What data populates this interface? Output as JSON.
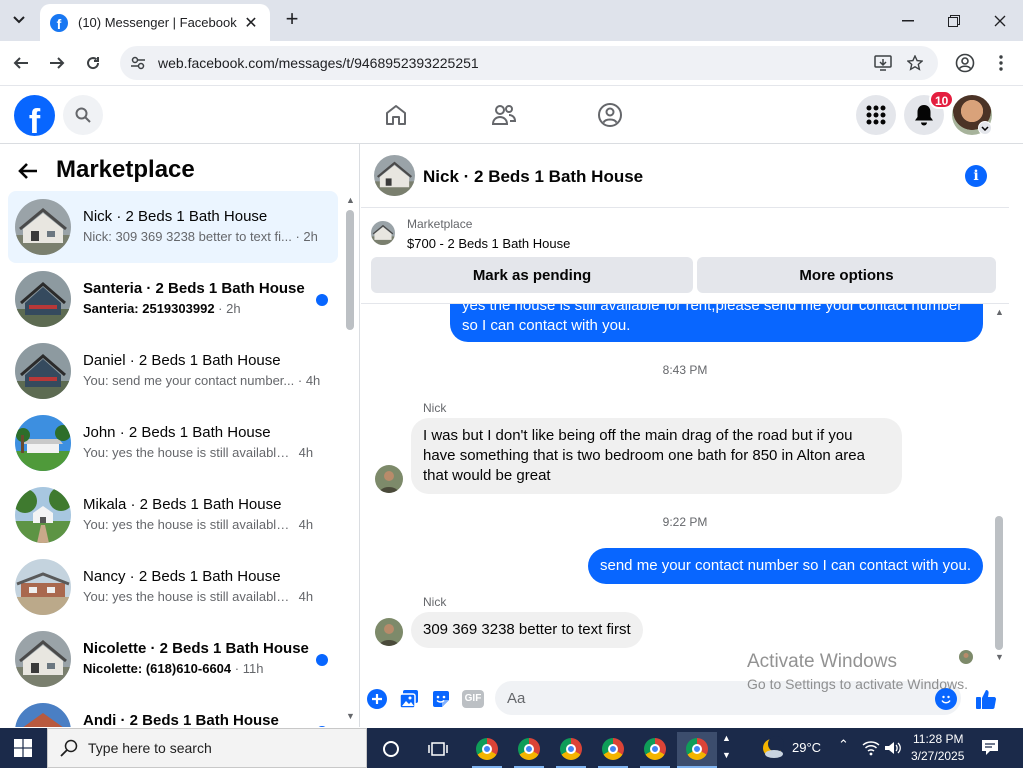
{
  "browser": {
    "tab_title": "(10) Messenger | Facebook",
    "url": "web.facebook.com/messages/t/9468952393225251"
  },
  "fb": {
    "logo_letter": "f",
    "notification_count": "10"
  },
  "marketplace": {
    "title": "Marketplace",
    "conversations": [
      {
        "name": "Nick · 2 Beds 1 Bath House",
        "preview": "Nick: 309 369 3238 better to text fi...",
        "time": "2h"
      },
      {
        "name": "Santeria · 2 Beds 1 Bath House",
        "preview": "Santeria: 2519303992",
        "time": "2h"
      },
      {
        "name": "Daniel · 2 Beds 1 Bath House",
        "preview": "You: send me your contact number...",
        "time": "4h"
      },
      {
        "name": "John · 2 Beds 1 Bath House",
        "preview": "You: yes the house is still available f...",
        "time": "4h"
      },
      {
        "name": "Mikala · 2 Beds 1 Bath House",
        "preview": "You: yes the house is still available f...",
        "time": "4h"
      },
      {
        "name": "Nancy · 2 Beds 1 Bath House",
        "preview": "You: yes the house is still available f...",
        "time": "4h"
      },
      {
        "name": "Nicolette · 2 Beds 1 Bath House",
        "preview": "Nicolette: (618)610-6604",
        "time": "11h"
      },
      {
        "name": "Andi · 2 Beds 1 Bath House",
        "preview": "",
        "time": ""
      }
    ]
  },
  "chat": {
    "header_name": "Nick · 2 Beds 1 Bath House",
    "listing": {
      "category": "Marketplace",
      "title": "$700 - 2 Beds 1 Bath House"
    },
    "mark_pending_label": "Mark as pending",
    "more_options_label": "More options",
    "messages": {
      "out1_line1": "yes the house is still available for rent,please send me your contact number",
      "out1_line2": "so I can contact with you.",
      "ts1": "8:43 PM",
      "sender1": "Nick",
      "in1_line1": "I was but I don't like being off the main drag of the road but if you",
      "in1_line2": "have something that is two bedroom one bath for 850 in Alton area",
      "in1_line3": "that would be great",
      "ts2": "9:22 PM",
      "out2": "send me your contact number so I can contact with you.",
      "sender2": "Nick",
      "in2": "309 369 3238 better to text first"
    },
    "composer_placeholder": "Aa",
    "gif_label": "GIF"
  },
  "watermark": {
    "line1": "Activate Windows",
    "line2": "Go to Settings to activate Windows."
  },
  "taskbar": {
    "search_placeholder": "Type here to search",
    "temperature": "29°C",
    "time": "11:28 PM",
    "date": "3/27/2025"
  }
}
